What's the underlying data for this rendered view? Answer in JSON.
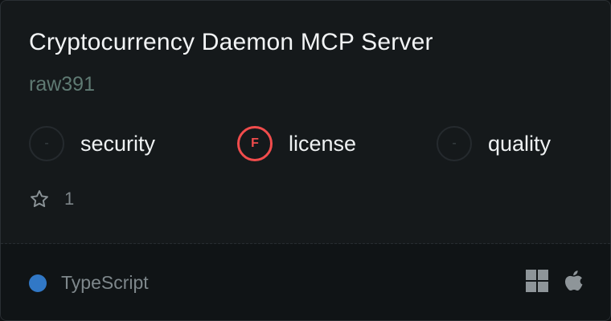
{
  "card": {
    "title": "Cryptocurrency Daemon MCP Server",
    "author": "raw391",
    "scores": [
      {
        "name": "security",
        "grade": "-",
        "state": "empty"
      },
      {
        "name": "license",
        "grade": "F",
        "state": "fail"
      },
      {
        "name": "quality",
        "grade": "-",
        "state": "empty"
      }
    ],
    "stars": {
      "icon": "star-outline-icon",
      "count": "1"
    },
    "language": {
      "name": "TypeScript",
      "color": "#3178c6"
    },
    "platforms": [
      {
        "name": "windows",
        "icon": "windows-icon"
      },
      {
        "name": "macos",
        "icon": "apple-icon"
      }
    ]
  },
  "colors": {
    "background": "#15191b",
    "footer": "#101416",
    "title": "#f2f4f5",
    "author": "#5f7a73",
    "fail": "#f14c4c",
    "muted": "#7e878b"
  }
}
